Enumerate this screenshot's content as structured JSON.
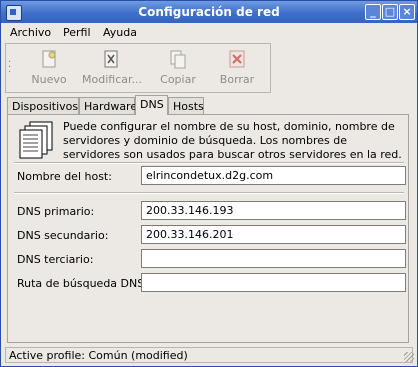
{
  "window": {
    "title": "Configuración de red"
  },
  "menubar": {
    "items": [
      "Archivo",
      "Perfil",
      "Ayuda"
    ]
  },
  "toolbar": {
    "items": [
      "Nuevo",
      "Modificar...",
      "Copiar",
      "Borrar"
    ]
  },
  "tabs": [
    "Dispositivos",
    "Hardware",
    "DNS",
    "Hosts"
  ],
  "dns": {
    "info": "Puede configurar el nombre de su host, dominio, nombre de servidores y dominio de búsqueda. Los nombres de servidores son usados para buscar otros servidores en la red.",
    "hostname_label": "Nombre del host:",
    "hostname_value": "elrincondetux.d2g.com",
    "primary_label": "DNS primario:",
    "primary_value": "200.33.146.193",
    "secondary_label": "DNS secundario:",
    "secondary_value": "200.33.146.201",
    "tertiary_label": "DNS terciario:",
    "tertiary_value": "",
    "search_label": "Ruta de búsqueda DNS:",
    "search_value": ""
  },
  "status": {
    "text": "Active profile: Común (modified)"
  },
  "icons": [
    "window-icon",
    "minimize-icon",
    "maximize-icon",
    "close-icon",
    "new-icon",
    "edit-icon",
    "copy-icon",
    "delete-icon",
    "dns-info-icon"
  ]
}
